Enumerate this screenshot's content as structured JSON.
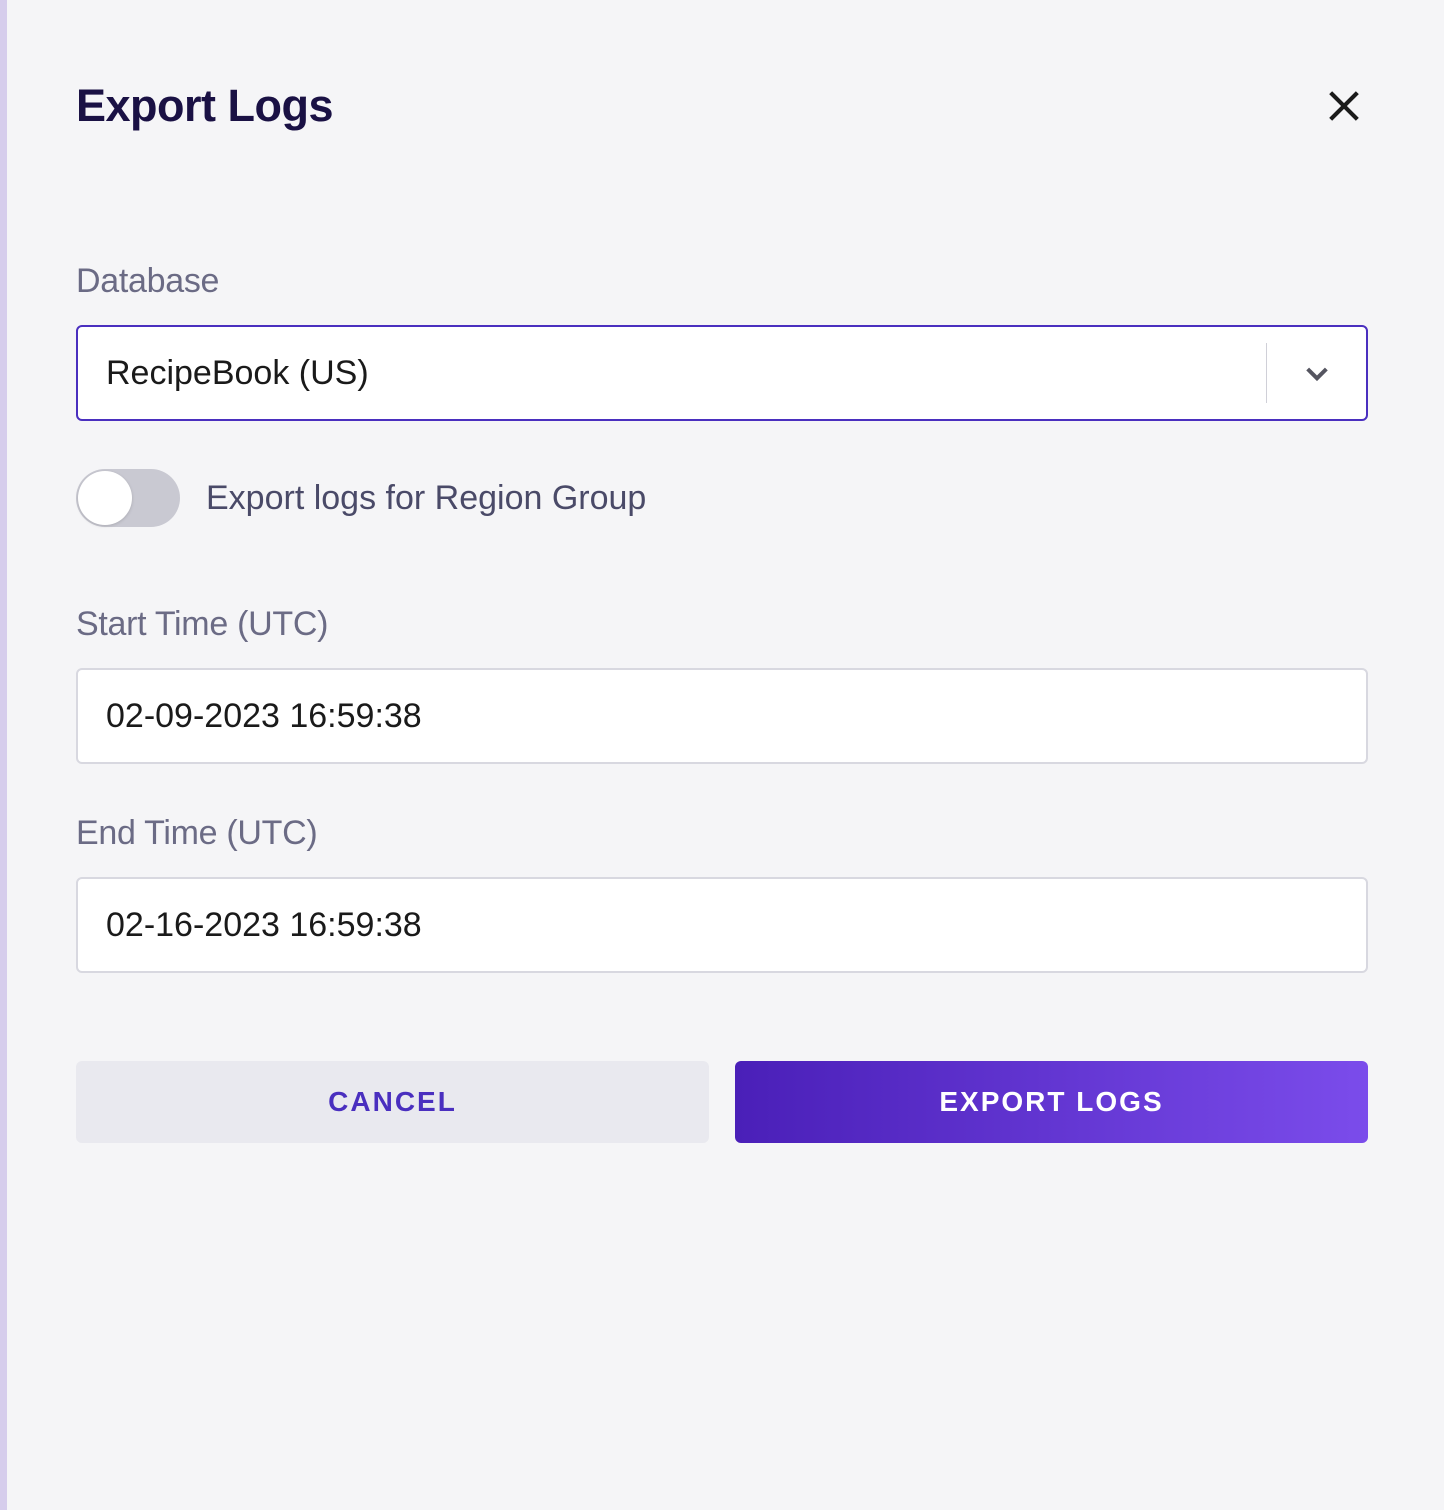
{
  "modal": {
    "title": "Export Logs",
    "database": {
      "label": "Database",
      "value": "RecipeBook (US)"
    },
    "region_toggle": {
      "label": "Export logs for Region Group",
      "enabled": false
    },
    "start_time": {
      "label": "Start Time (UTC)",
      "value": "02-09-2023 16:59:38"
    },
    "end_time": {
      "label": "End Time (UTC)",
      "value": "02-16-2023 16:59:38"
    },
    "buttons": {
      "cancel": "CANCEL",
      "submit": "EXPORT LOGS"
    }
  }
}
